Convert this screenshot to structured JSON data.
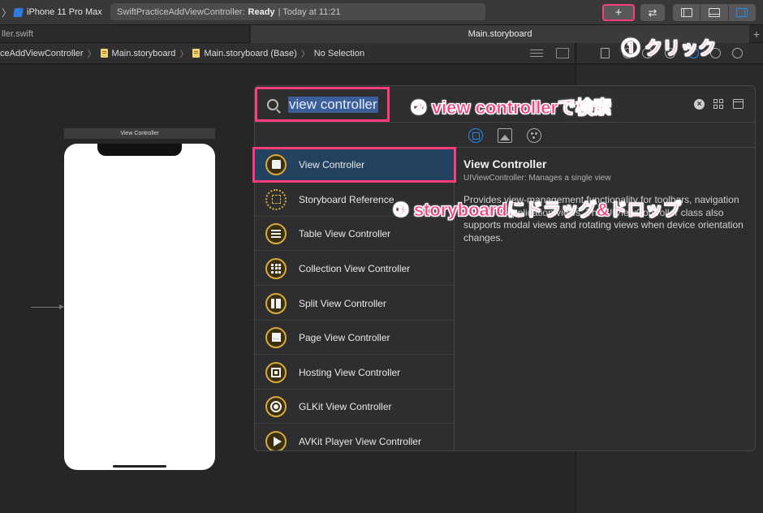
{
  "toolbar": {
    "chevron": "〉",
    "device": "iPhone 11 Pro Max",
    "status_project": "SwiftPracticeAddViewController:",
    "status_state": "Ready",
    "status_time": "| Today at 11:21",
    "plus_icon": "+",
    "swap_icon": "⇄"
  },
  "tabs": {
    "left": "ller.swift",
    "active": "Main.storyboard",
    "add": "+"
  },
  "jumpbar": {
    "crumbs": [
      "ceAddViewController",
      "Main.storyboard",
      "Main.storyboard (Base)",
      "No Selection"
    ],
    "sep": "〉"
  },
  "canvas": {
    "scene_title": "View Controller"
  },
  "library": {
    "search_value": "view controller",
    "clear_icon": "×",
    "items": [
      {
        "label": "View Controller",
        "selected": true
      },
      {
        "label": "Storyboard Reference"
      },
      {
        "label": "Table View Controller"
      },
      {
        "label": "Collection View Controller"
      },
      {
        "label": "Split View Controller"
      },
      {
        "label": "Page View Controller"
      },
      {
        "label": "Hosting View Controller"
      },
      {
        "label": "GLKit View Controller"
      },
      {
        "label": "AVKit Player View Controller"
      }
    ],
    "detail": {
      "title": "View Controller",
      "subtitle": "UIViewController: Manages a single view",
      "body": "Provides view-management functionality for toolbars, navigation bars, and application views. The UIViewController class also supports modal views and rotating views when device orientation changes."
    }
  },
  "annotations": {
    "a1": "① クリック",
    "a2": "② view controllerで検索",
    "a3": "③ storyboardにドラッグ&ドロップ"
  },
  "colors": {
    "highlight": "#ff3c7a",
    "accent": "#1e8cf0",
    "icon_gold": "#d9a93a"
  }
}
